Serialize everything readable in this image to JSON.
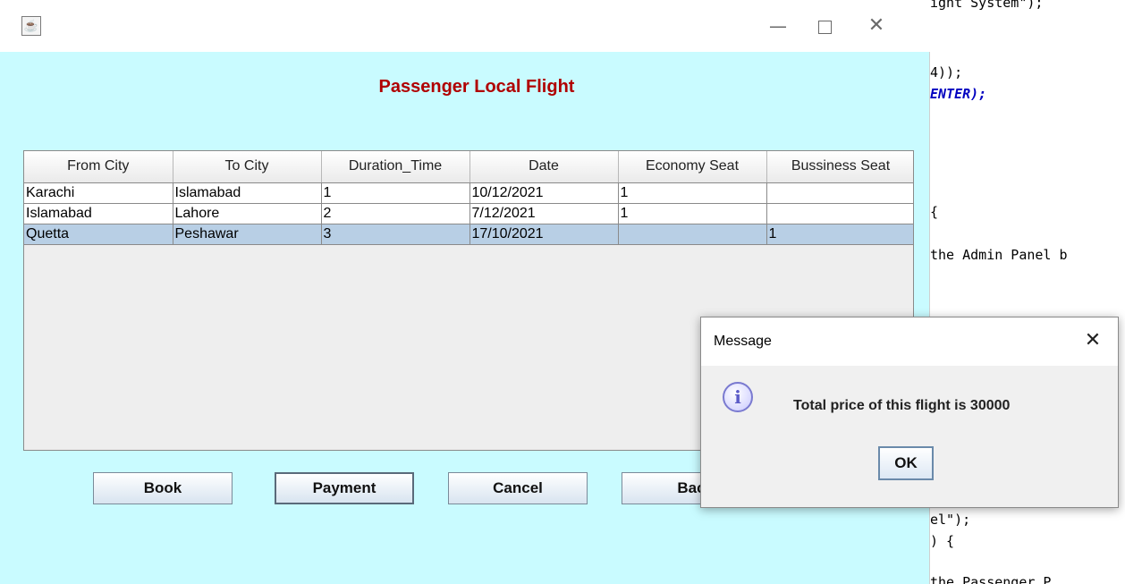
{
  "window": {
    "icon": "java-coffee-icon",
    "title": "",
    "controls": {
      "minimize": "—",
      "maximize": "",
      "close": "✕"
    }
  },
  "page": {
    "title": "Passenger Local Flight"
  },
  "table": {
    "columns": [
      "From City",
      "To City",
      "Duration_Time",
      "Date",
      "Economy Seat",
      "Bussiness Seat"
    ],
    "rows": [
      [
        "Karachi",
        "Islamabad",
        "1",
        "10/12/2021",
        "1",
        ""
      ],
      [
        "Islamabad",
        "Lahore",
        "2",
        "7/12/2021",
        "1",
        ""
      ],
      [
        "Quetta",
        "Peshawar",
        "3",
        "17/10/2021",
        "",
        "1"
      ]
    ],
    "selected_row": 2
  },
  "buttons": {
    "book": "Book",
    "payment": "Payment",
    "cancel": "Cancel",
    "back": "Bac"
  },
  "dialog": {
    "title": "Message",
    "close": "✕",
    "icon": "information-icon",
    "icon_glyph": "i",
    "message": "Total price of this flight is 30000",
    "ok": "OK"
  },
  "code_editor": {
    "lines": [
      "ight System\");",
      "",
      "4));",
      "ENTER);",
      "",
      "",
      "",
      "{",
      "",
      "the Admin Panel b",
      "",
      "",
      "",
      "",
      "",
      "",
      "",
      "",
      "el\");",
      ") {",
      "",
      "the Passenger P"
    ]
  }
}
